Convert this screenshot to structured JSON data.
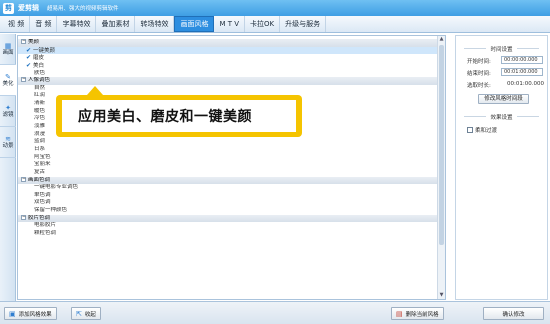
{
  "app": {
    "name": "爱剪辑",
    "logo": "剪",
    "slogan": "超易用、强大的视频剪辑软件"
  },
  "menu": [
    "视  频",
    "音  频",
    "字幕特效",
    "叠加素材",
    "转场特效",
    "画面风格",
    "M T V",
    "卡拉OK",
    "升级与服务"
  ],
  "sidetabs": [
    {
      "label": "画面",
      "icon": "image-icon"
    },
    {
      "label": "美化",
      "icon": "magic-wand-icon"
    },
    {
      "label": "滤镜",
      "icon": "filter-icon"
    },
    {
      "label": "动景",
      "icon": "motion-icon"
    }
  ],
  "list": {
    "categories": [
      {
        "label": "美颜",
        "expander": "⊟",
        "items": [
          {
            "label": "一键美颜",
            "checked": true,
            "selected": true
          },
          {
            "label": "磨皮",
            "checked": true,
            "selected": false
          },
          {
            "label": "美白",
            "checked": true,
            "selected": false
          },
          {
            "label": "肤色",
            "checked": false,
            "selected": false
          }
        ]
      },
      {
        "label": "人像调色",
        "expander": "⊟",
        "items": [
          {
            "label": "自然"
          },
          {
            "label": "红润"
          },
          {
            "label": "清新"
          },
          {
            "label": "暖色"
          },
          {
            "label": "冷色"
          },
          {
            "label": "淡雅"
          },
          {
            "label": "浪漫"
          },
          {
            "label": "蓝调"
          },
          {
            "label": "日系"
          },
          {
            "label": "阿宝色"
          },
          {
            "label": "宝丽来"
          },
          {
            "label": "复古"
          }
        ]
      },
      {
        "label": "画面色调",
        "expander": "⊟",
        "items": [
          {
            "label": "一键电影专业调色"
          },
          {
            "label": "单色调"
          },
          {
            "label": "双色调"
          },
          {
            "label": "保留一种颜色"
          }
        ]
      },
      {
        "label": "胶片色调",
        "expander": "⊟",
        "items": [
          {
            "label": "电影胶片"
          },
          {
            "label": "颗粒色调"
          }
        ]
      }
    ]
  },
  "callout": {
    "text": "应用美白、磨皮和一键美颜"
  },
  "panel": {
    "time_section": "时间设置",
    "start_label": "开始时间:",
    "start_value": "00:00:00.000",
    "end_label": "结束时间:",
    "end_value": "00:01:00.000",
    "duration_label": "选取时长:",
    "duration_value": "00:01:00.000",
    "modify_time_button": "修改风格时间段",
    "effect_section": "效果设置",
    "soft_filter_label": "柔和过渡"
  },
  "bottom": {
    "add_style": "添加风格效果",
    "collect": "收起",
    "delete_style": "删除当前风格",
    "confirm": "确认修改"
  },
  "colors": {
    "accent": "#2d8ee0",
    "callout": "#f5c400",
    "selected_row": "#cfe6fb"
  }
}
